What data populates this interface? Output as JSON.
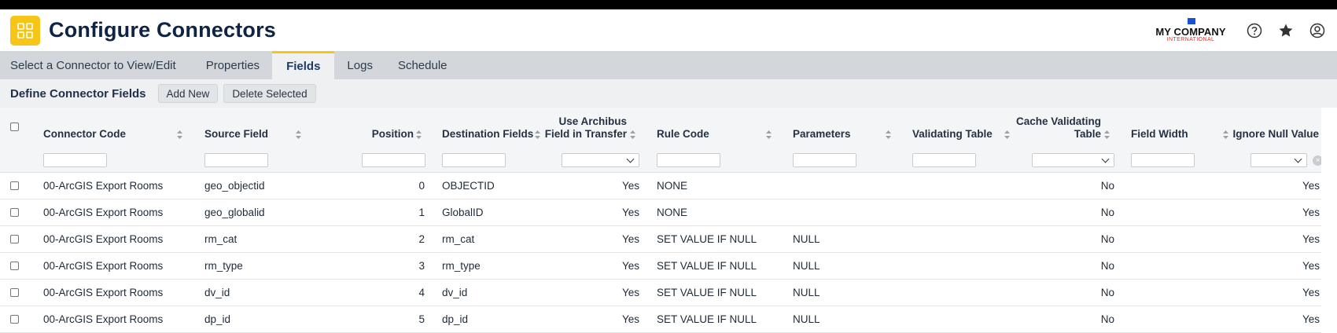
{
  "header": {
    "title": "Configure Connectors",
    "logo_main": "MY COMPANY",
    "logo_sub": "INTERNATIONAL",
    "icons": [
      "help-icon",
      "star-icon",
      "user-icon"
    ]
  },
  "tabs": [
    {
      "label": "Select a Connector to View/Edit",
      "active": false
    },
    {
      "label": "Properties",
      "active": false
    },
    {
      "label": "Fields",
      "active": true
    },
    {
      "label": "Logs",
      "active": false
    },
    {
      "label": "Schedule",
      "active": false
    }
  ],
  "toolbar": {
    "title": "Define Connector Fields",
    "add_new": "Add New",
    "delete_selected": "Delete Selected"
  },
  "columns": {
    "connector_code": "Connector Code",
    "source_field": "Source Field",
    "position": "Position",
    "destination_fields": "Destination Fields",
    "use_archibus_1": "Use Archibus",
    "use_archibus_2": "Field in Transfer",
    "rule_code": "Rule Code",
    "parameters": "Parameters",
    "validating_table": "Validating Table",
    "cache_validating_1": "Cache Validating",
    "cache_validating_2": "Table",
    "field_width": "Field Width",
    "ignore_null_value": "Ignore Null Value"
  },
  "rows": [
    {
      "connector_code": "00-ArcGIS Export Rooms",
      "source_field": "geo_objectid",
      "position": "0",
      "destination": "OBJECTID",
      "use_archibus": "Yes",
      "rule_code": "NONE",
      "parameters": "",
      "validating_table": "",
      "cache_validating": "No",
      "field_width": "",
      "ignore_null": "Yes"
    },
    {
      "connector_code": "00-ArcGIS Export Rooms",
      "source_field": "geo_globalid",
      "position": "1",
      "destination": "GlobalID",
      "use_archibus": "Yes",
      "rule_code": "NONE",
      "parameters": "",
      "validating_table": "",
      "cache_validating": "No",
      "field_width": "",
      "ignore_null": "Yes"
    },
    {
      "connector_code": "00-ArcGIS Export Rooms",
      "source_field": "rm_cat",
      "position": "2",
      "destination": "rm_cat",
      "use_archibus": "Yes",
      "rule_code": "SET VALUE IF NULL",
      "parameters": "NULL",
      "validating_table": "",
      "cache_validating": "No",
      "field_width": "",
      "ignore_null": "Yes"
    },
    {
      "connector_code": "00-ArcGIS Export Rooms",
      "source_field": "rm_type",
      "position": "3",
      "destination": "rm_type",
      "use_archibus": "Yes",
      "rule_code": "SET VALUE IF NULL",
      "parameters": "NULL",
      "validating_table": "",
      "cache_validating": "No",
      "field_width": "",
      "ignore_null": "Yes"
    },
    {
      "connector_code": "00-ArcGIS Export Rooms",
      "source_field": "dv_id",
      "position": "4",
      "destination": "dv_id",
      "use_archibus": "Yes",
      "rule_code": "SET VALUE IF NULL",
      "parameters": "NULL",
      "validating_table": "",
      "cache_validating": "No",
      "field_width": "",
      "ignore_null": "Yes"
    },
    {
      "connector_code": "00-ArcGIS Export Rooms",
      "source_field": "dp_id",
      "position": "5",
      "destination": "dp_id",
      "use_archibus": "Yes",
      "rule_code": "SET VALUE IF NULL",
      "parameters": "NULL",
      "validating_table": "",
      "cache_validating": "No",
      "field_width": "",
      "ignore_null": "Yes"
    }
  ],
  "colors": {
    "accent": "#f5c518",
    "title": "#0f2444",
    "tab_bar": "#d3d7db",
    "toolbar_bg": "#eef0f2"
  }
}
